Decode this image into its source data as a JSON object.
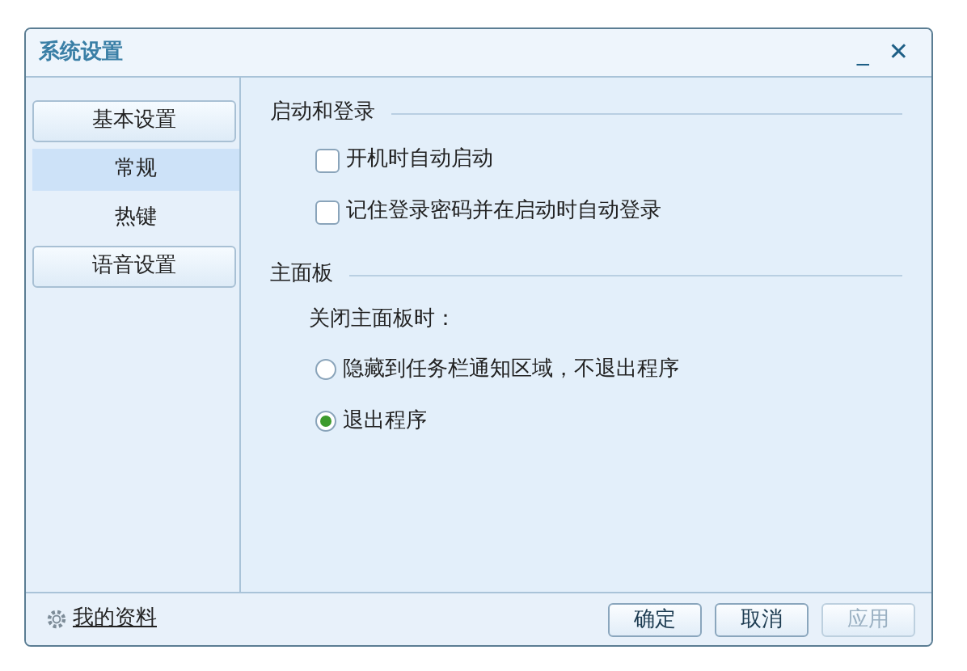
{
  "window": {
    "title": "系统设置",
    "controls": [
      "_",
      "✕"
    ]
  },
  "sidebar": {
    "items": [
      {
        "kind": "group",
        "label": "基本设置",
        "children": [
          {
            "label": "常规",
            "selected": true
          },
          {
            "label": "热键",
            "selected": false
          }
        ]
      },
      {
        "kind": "group",
        "label": "语音设置"
      }
    ]
  },
  "sections": [
    {
      "title": "启动和登录",
      "options": [
        {
          "kind": "checkbox",
          "label": "开机时自动启动",
          "checked": false
        },
        {
          "kind": "checkbox",
          "label": "记住登录密码并在启动时自动登录",
          "checked": false
        }
      ]
    },
    {
      "title": "主面板",
      "prompt": "关闭主面板时：",
      "options": [
        {
          "kind": "radio",
          "label": "隐藏到任务栏通知区域，不退出程序",
          "checked": false
        },
        {
          "kind": "radio",
          "label": "退出程序",
          "checked": true
        }
      ]
    }
  ],
  "footer": {
    "link": "我的资料",
    "buttons": [
      {
        "label": "确定",
        "disabled": false
      },
      {
        "label": "取消",
        "disabled": false
      },
      {
        "label": "应用",
        "disabled": true
      }
    ]
  }
}
